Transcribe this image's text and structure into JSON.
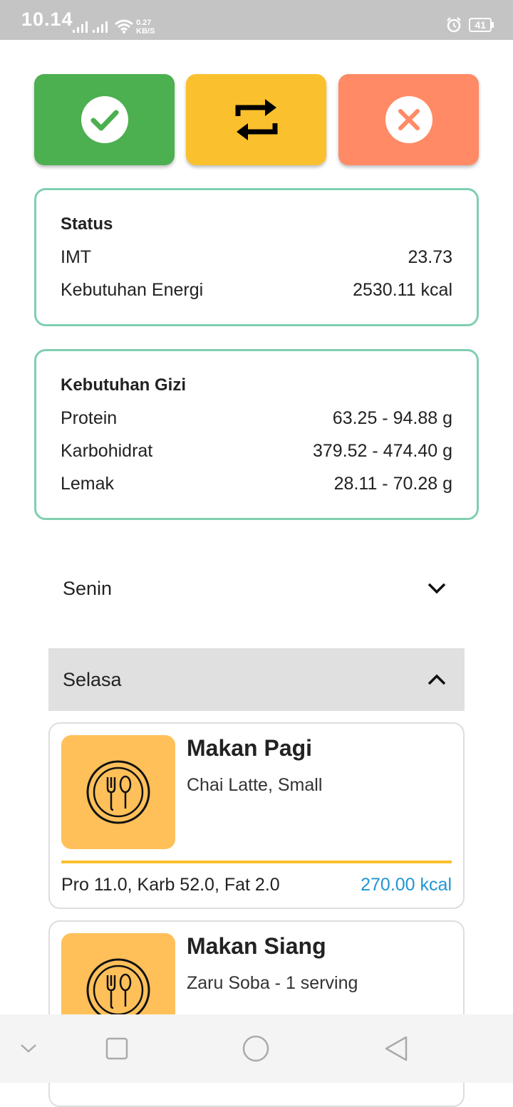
{
  "status_bar": {
    "time": "10.14",
    "net_speed_value": "0.27",
    "net_speed_unit": "KB/S",
    "battery": "41"
  },
  "actions": {
    "confirm_icon": "check-circle-icon",
    "swap_icon": "repeat-icon",
    "cancel_icon": "close-circle-icon",
    "confirm_color": "#4caf50",
    "swap_color": "#fbc02d",
    "cancel_color": "#ff8a65"
  },
  "status_card": {
    "title": "Status",
    "rows": [
      {
        "label": "IMT",
        "value": "23.73"
      },
      {
        "label": "Kebutuhan Energi",
        "value": "2530.11 kcal"
      }
    ]
  },
  "gizi_card": {
    "title": "Kebutuhan Gizi",
    "rows": [
      {
        "label": "Protein",
        "value": "63.25 - 94.88 g"
      },
      {
        "label": "Karbohidrat",
        "value": "379.52 - 474.40 g"
      },
      {
        "label": "Lemak",
        "value": "28.11 - 70.28 g"
      }
    ]
  },
  "days": [
    {
      "label": "Senin",
      "expanded": false
    },
    {
      "label": "Selasa",
      "expanded": true
    }
  ],
  "meals": [
    {
      "title": "Makan Pagi",
      "description": "Chai Latte, Small",
      "macros": "Pro 11.0, Karb 52.0, Fat 2.0",
      "kcal": "270.00 kcal"
    },
    {
      "title": "Makan Siang",
      "description": "Zaru Soba - 1 serving"
    }
  ]
}
